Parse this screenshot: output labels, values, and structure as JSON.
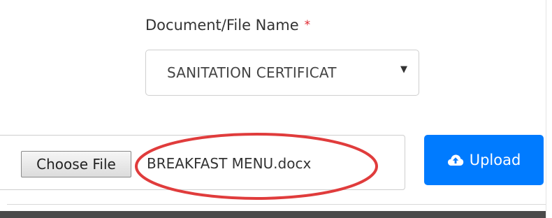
{
  "form": {
    "document_label": "Document/File Name",
    "required_marker": "*",
    "document_select": {
      "selected_value": "SANITATION CERTIFICAT",
      "arrow_glyph": "▼"
    },
    "file_input": {
      "button_label": "Choose File",
      "selected_file": "BREAKFAST MENU.docx"
    },
    "upload_button": {
      "label": "Upload",
      "icon": "cloud-upload-icon"
    }
  },
  "colors": {
    "primary": "#007bff",
    "required": "#e0262f",
    "annotation": "#e03c3c"
  }
}
